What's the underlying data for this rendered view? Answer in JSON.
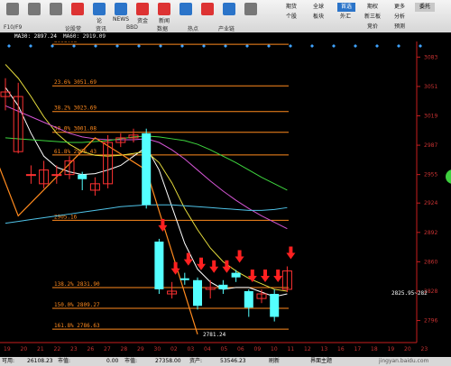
{
  "toolbar": {
    "left_buttons": [
      {
        "label": "",
        "icon": "back-icon"
      },
      {
        "label": "",
        "icon": "window-icon"
      },
      {
        "label": "",
        "icon": "refresh-icon"
      },
      {
        "label": "",
        "icon": "chart-icon"
      },
      {
        "label": "论",
        "icon": "forum-icon"
      },
      {
        "label": "NEWS",
        "icon": "news-icon"
      },
      {
        "label": "资金",
        "icon": "fund-icon"
      },
      {
        "label": "新闻",
        "icon": "news2-icon"
      },
      {
        "label": "",
        "icon": "market-icon"
      },
      {
        "label": "",
        "icon": "flag-icon"
      },
      {
        "label": "",
        "icon": "sector-icon"
      },
      {
        "label": "",
        "icon": "user-icon"
      }
    ],
    "left_sublabels": [
      "F10/F9",
      "",
      "论股堂",
      "资讯",
      "BBD",
      "数据",
      "热点",
      "产业链"
    ],
    "right_grid": [
      [
        "期货",
        "全球",
        "股指",
        "期权",
        "更多"
      ],
      [
        "个股",
        "板块",
        "外汇",
        "新三板",
        "分析"
      ],
      [
        "",
        "",
        "",
        "竞价",
        "预测"
      ]
    ],
    "blue_tag": "首选",
    "top_right_label": "委托"
  },
  "tag_strip": {
    "ma30_label": "MA30: 2897.24",
    "ma60_label": "MA60: 2919.09"
  },
  "chart_data": {
    "type": "candlestick",
    "y_ticks": [
      3083,
      3051,
      3019,
      2987,
      2955,
      2924,
      2892,
      2860,
      2828,
      2796
    ],
    "ylim": [
      2772,
      3100
    ],
    "x_tick_labels": [
      "19",
      "20",
      "21",
      "22",
      "23",
      "26",
      "27",
      "28",
      "29",
      "30",
      "02",
      "03",
      "04",
      "05",
      "06",
      "09",
      "10",
      "11",
      "12",
      "13",
      "16",
      "17",
      "18",
      "19",
      "20",
      "23"
    ],
    "fib_levels": [
      {
        "label": "3096.96",
        "value": 3096.96
      },
      {
        "label": "23.6%  3051.69",
        "value": 3051.69
      },
      {
        "label": "38.2%  3023.69",
        "value": 3023.69
      },
      {
        "label": "50.0%  3001.08",
        "value": 3001.08
      },
      {
        "label": "61.8%  2976.43",
        "value": 2976.43
      },
      {
        "label": "2905.16",
        "value": 2905.16
      },
      {
        "label": "138.2%  2831.90",
        "value": 2831.9
      },
      {
        "label": "150.0%  2809.27",
        "value": 2809.27
      },
      {
        "label": "161.8%  2786.63",
        "value": 2786.63
      }
    ],
    "low_label": "2781.24",
    "right_label": "2825.95~282",
    "candles": [
      {
        "o": 3040,
        "c": 3045,
        "h": 3060,
        "l": 3025
      },
      {
        "o": 2980,
        "c": 3040,
        "h": 3055,
        "l": 2978
      },
      {
        "o": 2955,
        "c": 2955,
        "h": 2965,
        "l": 2945
      },
      {
        "o": 2945,
        "c": 2960,
        "h": 2970,
        "l": 2940
      },
      {
        "o": 2955,
        "c": 2955,
        "h": 2965,
        "l": 2945
      },
      {
        "o": 2955,
        "c": 2970,
        "h": 2975,
        "l": 2950
      },
      {
        "o": 2955,
        "c": 2950,
        "h": 2958,
        "l": 2938
      },
      {
        "o": 2938,
        "c": 2945,
        "h": 2952,
        "l": 2932
      },
      {
        "o": 2945,
        "c": 2990,
        "h": 2998,
        "l": 2940
      },
      {
        "o": 2990,
        "c": 2995,
        "h": 3000,
        "l": 2985
      },
      {
        "o": 2995,
        "c": 2998,
        "h": 3005,
        "l": 2990
      },
      {
        "o": 3000,
        "c": 2922,
        "h": 3005,
        "l": 2918
      },
      {
        "o": 2882,
        "c": 2830,
        "h": 2885,
        "l": 2825
      },
      {
        "o": 2825,
        "c": 2828,
        "h": 2838,
        "l": 2820
      },
      {
        "o": 2842,
        "c": 2840,
        "h": 2848,
        "l": 2835
      },
      {
        "o": 2840,
        "c": 2812,
        "h": 2843,
        "l": 2808
      },
      {
        "o": 2830,
        "c": 2832,
        "h": 2840,
        "l": 2820
      },
      {
        "o": 2835,
        "c": 2830,
        "h": 2840,
        "l": 2825
      },
      {
        "o": 2848,
        "c": 2843,
        "h": 2851,
        "l": 2838
      },
      {
        "o": 2828,
        "c": 2810,
        "h": 2830,
        "l": 2800
      },
      {
        "o": 2820,
        "c": 2825,
        "h": 2830,
        "l": 2815
      },
      {
        "o": 2825,
        "c": 2800,
        "h": 2830,
        "l": 2795
      },
      {
        "o": 2830,
        "c": 2850,
        "h": 2855,
        "l": 2827
      }
    ],
    "ma_lines": [
      {
        "name": "MA5",
        "color": "#ffffff",
        "values": [
          3050,
          3030,
          3000,
          2975,
          2963,
          2958,
          2955,
          2956,
          2960,
          2965,
          2975,
          2985,
          2960,
          2920,
          2880,
          2852,
          2838,
          2830,
          2832,
          2832,
          2827,
          2822,
          2825
        ]
      },
      {
        "name": "MA10",
        "color": "#e6dc3c",
        "values": [
          3075,
          3060,
          3040,
          3018,
          3000,
          2988,
          2980,
          2976,
          2975,
          2976,
          2978,
          2980,
          2968,
          2946,
          2918,
          2895,
          2875,
          2860,
          2850,
          2842,
          2836,
          2830,
          2828
        ]
      },
      {
        "name": "MA20",
        "color": "#d455d4",
        "values": [
          3030,
          3024,
          3018,
          3012,
          3006,
          3000,
          2996,
          2994,
          2993,
          2993,
          2993,
          2994,
          2990,
          2982,
          2972,
          2960,
          2948,
          2937,
          2927,
          2918,
          2910,
          2903,
          2896
        ]
      },
      {
        "name": "MA30",
        "color": "#3ed63e",
        "values": [
          2995,
          2994,
          2993,
          2992,
          2991,
          2990,
          2990,
          2991,
          2992,
          2994,
          2996,
          2997,
          2996,
          2994,
          2992,
          2988,
          2982,
          2975,
          2968,
          2960,
          2952,
          2945,
          2938
        ]
      },
      {
        "name": "MA60",
        "color": "#4fc3e8",
        "values": [
          2902,
          2904,
          2906,
          2908,
          2910,
          2912,
          2914,
          2916,
          2918,
          2920,
          2921,
          2922,
          2922,
          2922,
          2921,
          2920,
          2919,
          2918,
          2917,
          2916,
          2916,
          2917,
          2919
        ]
      }
    ],
    "colors": {
      "up": "#ff3232",
      "down": "#54ffff",
      "fib": "#ff8a1e",
      "axis": "#c81e1e",
      "arrow": "#ff2020"
    }
  },
  "statusbar": {
    "items": [
      "可用:",
      "26108.23",
      "市值:",
      "0.00",
      "市值:",
      "27358.00",
      "资产:",
      "53546.23",
      "刷新",
      "界面主题"
    ],
    "watermark": "jingyan.baidu.com"
  }
}
